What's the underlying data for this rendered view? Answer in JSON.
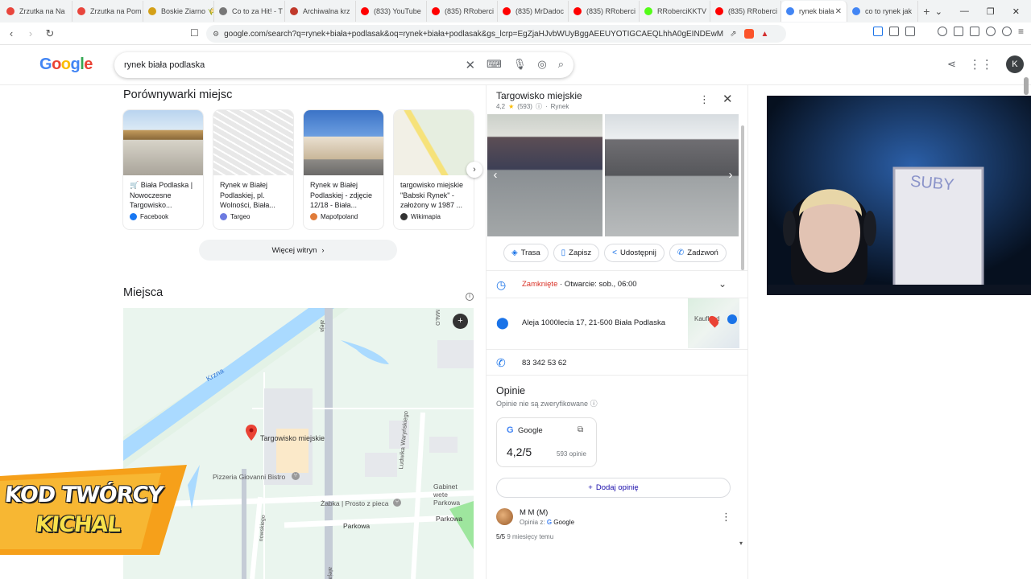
{
  "browser": {
    "tabs": [
      {
        "title": "Zrzutka na Na",
        "color": "#e8453c"
      },
      {
        "title": "Zrzutka na Pom",
        "color": "#e8453c"
      },
      {
        "title": "Boskie Ziarno 🌾",
        "color": "#d4a017"
      },
      {
        "title": "Co to za Hit! - T",
        "color": "#777777"
      },
      {
        "title": "Archiwalna krz",
        "color": "#c0392b"
      },
      {
        "title": "(833) YouTube",
        "color": "#ff0000"
      },
      {
        "title": "(835) RRoberci",
        "color": "#ff0000"
      },
      {
        "title": "(835) MrDadoc",
        "color": "#ff0000"
      },
      {
        "title": "(835) RRoberci",
        "color": "#ff0000"
      },
      {
        "title": "RRoberciKKTV",
        "color": "#53fc18"
      },
      {
        "title": "(835) RRoberci",
        "color": "#ff0000"
      },
      {
        "title": "rynek biała",
        "color": "#4285f4"
      },
      {
        "title": "co to rynek jak",
        "color": "#4285f4"
      }
    ],
    "url": "google.com/search?q=rynek+biała+podlasak&oq=rynek+biała+podlasak&gs_lcrp=EgZjaHJvbWUyBggAEEUYOTIGCAEQLhhA0gEINDEwM2owajGoA..."
  },
  "google": {
    "logo": "Google",
    "query": "rynek biała podlaska",
    "avatar_letter": "K"
  },
  "comparison": {
    "title": "Porównywarki miejsc",
    "cards": [
      {
        "text": "🛒 Biała Podlaska | Nowoczesne Targowisko...",
        "source": "Facebook",
        "source_color": "#1877f2"
      },
      {
        "text": "Rynek w Białej Podlaskiej, pl. Wolności, Biała...",
        "source": "Targeo",
        "source_color": "#6c7ae0"
      },
      {
        "text": "Rynek w Białej Podlaskiej - zdjęcie 12/18 - Biała...",
        "source": "Mapofpoland",
        "source_color": "#e07b39"
      },
      {
        "text": "targowisko miejskie \"Babski Rynek\" - założony w 1987 ...",
        "source": "Wikimapia",
        "source_color": "#333333"
      }
    ],
    "more_label": "Więcej witryn"
  },
  "places": {
    "title": "Miejsca",
    "map_labels": {
      "river": "Krzna",
      "pin": "Targowisko miejskie",
      "pizzeria": "Pizzeria Giovanni Bistro",
      "zabka": "Żabka | Prosto z pieca",
      "gabinet": "Gabinet wete Parkowa",
      "parkowa1": "Parkowa",
      "parkowa2": "Parkowa",
      "ludwika": "Ludwika Waryńskiego",
      "aleja": "aleja",
      "malo": "MAŁO",
      "nowo": "nowskiego"
    }
  },
  "knowledge_panel": {
    "title": "Targowisko miejskie",
    "rating": "4,2",
    "review_count": "(593)",
    "category": "Rynek",
    "actions": [
      {
        "label": "Trasa",
        "icon": "◈"
      },
      {
        "label": "Zapisz",
        "icon": "▯"
      },
      {
        "label": "Udostępnij",
        "icon": "<"
      },
      {
        "label": "Zadzwoń",
        "icon": "✆"
      }
    ],
    "hours_status": "Zamknięte",
    "hours_open": " · Otwarcie: sob., 06:00",
    "address": "Aleja 1000lecia 17, 21-500 Biała Podlaska",
    "phone": "83 342 53 62",
    "reviews_title": "Opinie",
    "reviews_unverified": "Opinie nie są zweryfikowane",
    "google_source": "Google",
    "google_score": "4,2/5",
    "google_count": "593 opinie",
    "add_review": "Dodaj opinię",
    "reviewer_name": "M M (M)",
    "reviewer_via": "Opinia z:",
    "reviewer_source": "Google",
    "review_score": "5/5",
    "review_age": "9 miesięcy temu",
    "mini_map_label": "Kaufland"
  },
  "overlay": {
    "banner_line1": "KOD TWÓRCY",
    "banner_line2": "KICHAL",
    "whiteboard": "SUBY"
  }
}
